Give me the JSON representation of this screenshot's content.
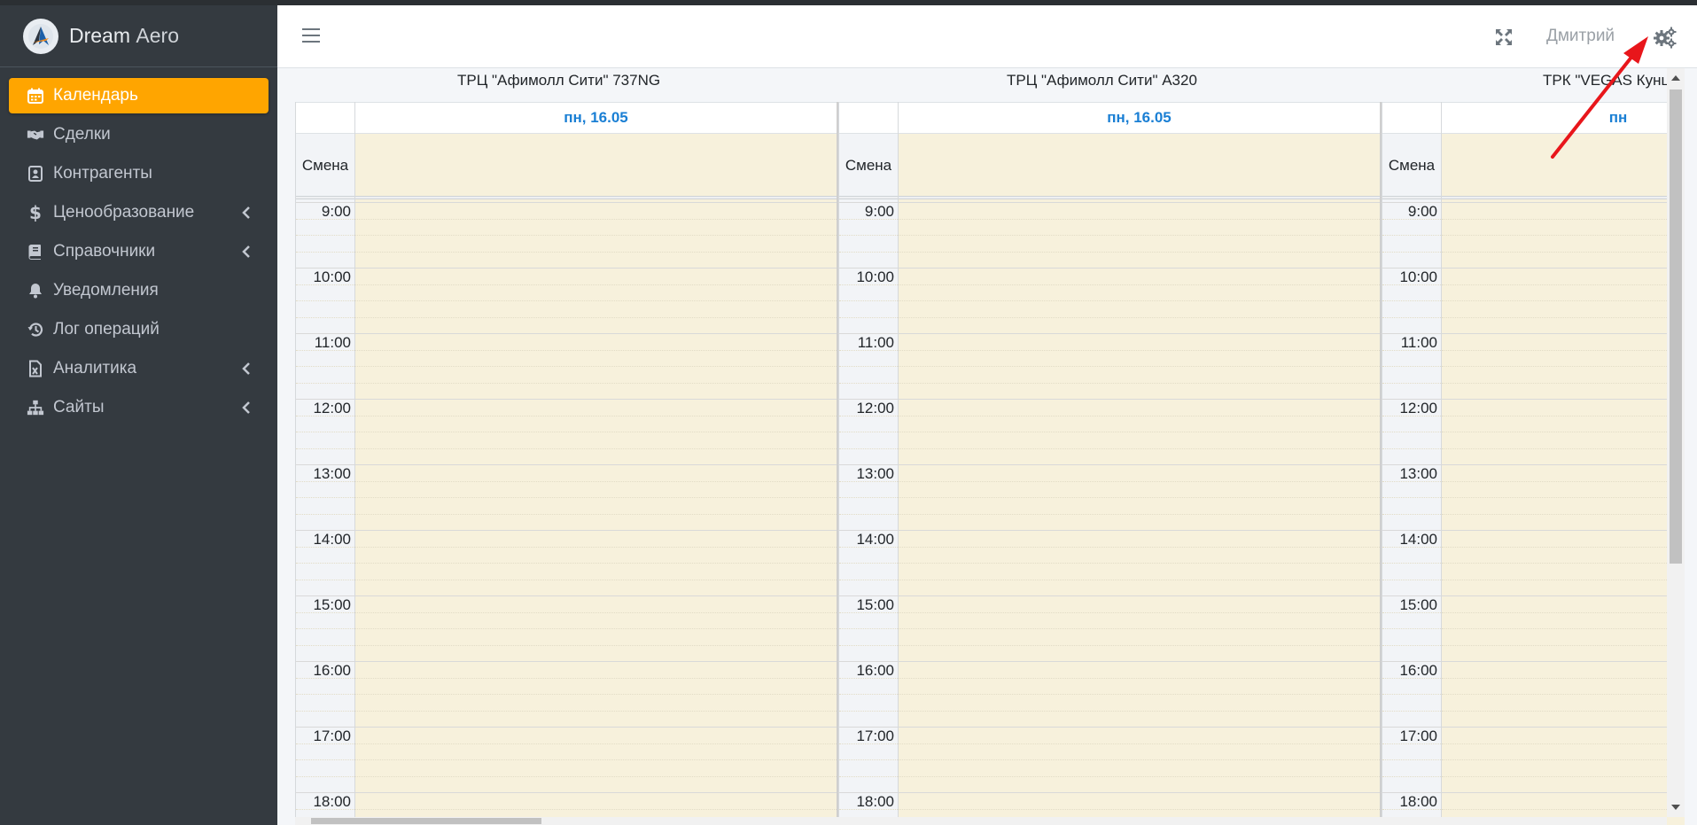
{
  "brand": {
    "name_bold": "Dream",
    "name_light": "Aero"
  },
  "sidebar": {
    "items": [
      {
        "label": "Календарь",
        "icon": "calendar-icon",
        "active": true
      },
      {
        "label": "Сделки",
        "icon": "handshake-icon"
      },
      {
        "label": "Контрагенты",
        "icon": "address-card-icon"
      },
      {
        "label": "Ценообразование",
        "icon": "dollar-icon",
        "expandable": true
      },
      {
        "label": "Справочники",
        "icon": "book-icon",
        "expandable": true
      },
      {
        "label": "Уведомления",
        "icon": "bell-icon"
      },
      {
        "label": "Лог операций",
        "icon": "history-icon"
      },
      {
        "label": "Аналитика",
        "icon": "excel-file-icon",
        "expandable": true
      },
      {
        "label": "Сайты",
        "icon": "sitemap-icon",
        "expandable": true
      }
    ]
  },
  "header": {
    "user_name": "Дмитрий",
    "icons": [
      "hamburger-icon",
      "fullscreen-icon",
      "gears-icon"
    ]
  },
  "calendar": {
    "resources": [
      {
        "title": "ТРЦ \"Афимолл Сити\" 737NG",
        "day": "пн, 16.05",
        "allday_label": "Смена"
      },
      {
        "title": "ТРЦ \"Афимолл Сити\" A320",
        "day": "пн, 16.05",
        "allday_label": "Смена"
      },
      {
        "title": "ТРК \"VEGAS Кунц",
        "day": "пн",
        "allday_label": "Смена"
      }
    ],
    "hours": [
      "9:00",
      "10:00",
      "11:00",
      "12:00",
      "13:00",
      "14:00",
      "15:00",
      "16:00",
      "17:00",
      "18:00"
    ]
  },
  "annotation": {
    "color": "#e8161b"
  }
}
